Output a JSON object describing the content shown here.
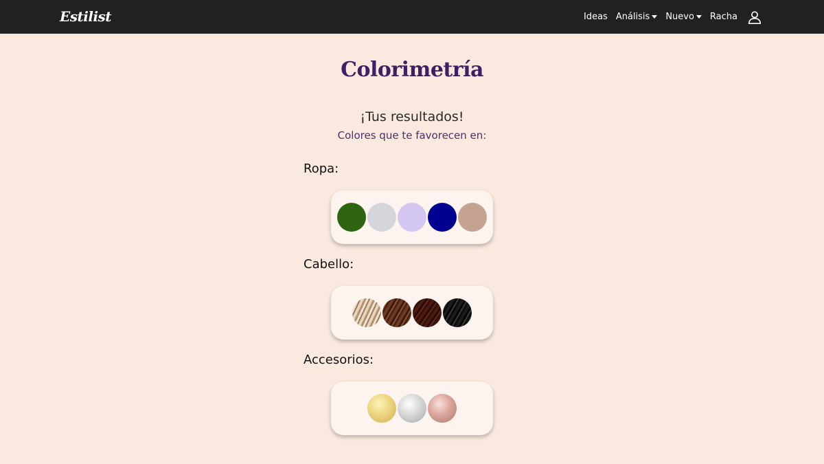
{
  "nav": {
    "brand": "Estilist",
    "links": [
      {
        "label": "Ideas",
        "dropdown": false
      },
      {
        "label": "Análisis",
        "dropdown": true
      },
      {
        "label": "Nuevo",
        "dropdown": true
      },
      {
        "label": "Racha",
        "dropdown": false
      }
    ],
    "user_icon": "user-icon"
  },
  "page": {
    "title": "Colorimetría",
    "results_title": "¡Tus resultados!",
    "results_subtitle": "Colores que te favorecen en:"
  },
  "sections": {
    "ropa": {
      "label": "Ropa:",
      "colors": [
        "#2f6412",
        "#d5d5dc",
        "#d3c6f0",
        "#00008e",
        "#c5a393"
      ]
    },
    "cabello": {
      "label": "Cabello:",
      "swatches": [
        "light-blonde-hair",
        "chestnut-brown-hair",
        "auburn-dark-hair",
        "black-hair"
      ]
    },
    "accesorios": {
      "label": "Accesorios:",
      "swatches": [
        "gold",
        "silver",
        "rose-gold"
      ]
    }
  },
  "colors": {
    "navbar_bg": "#212023",
    "page_bg": "#f9e9df",
    "title": "#3e1f63",
    "card_bg": "#fdf4ef"
  }
}
